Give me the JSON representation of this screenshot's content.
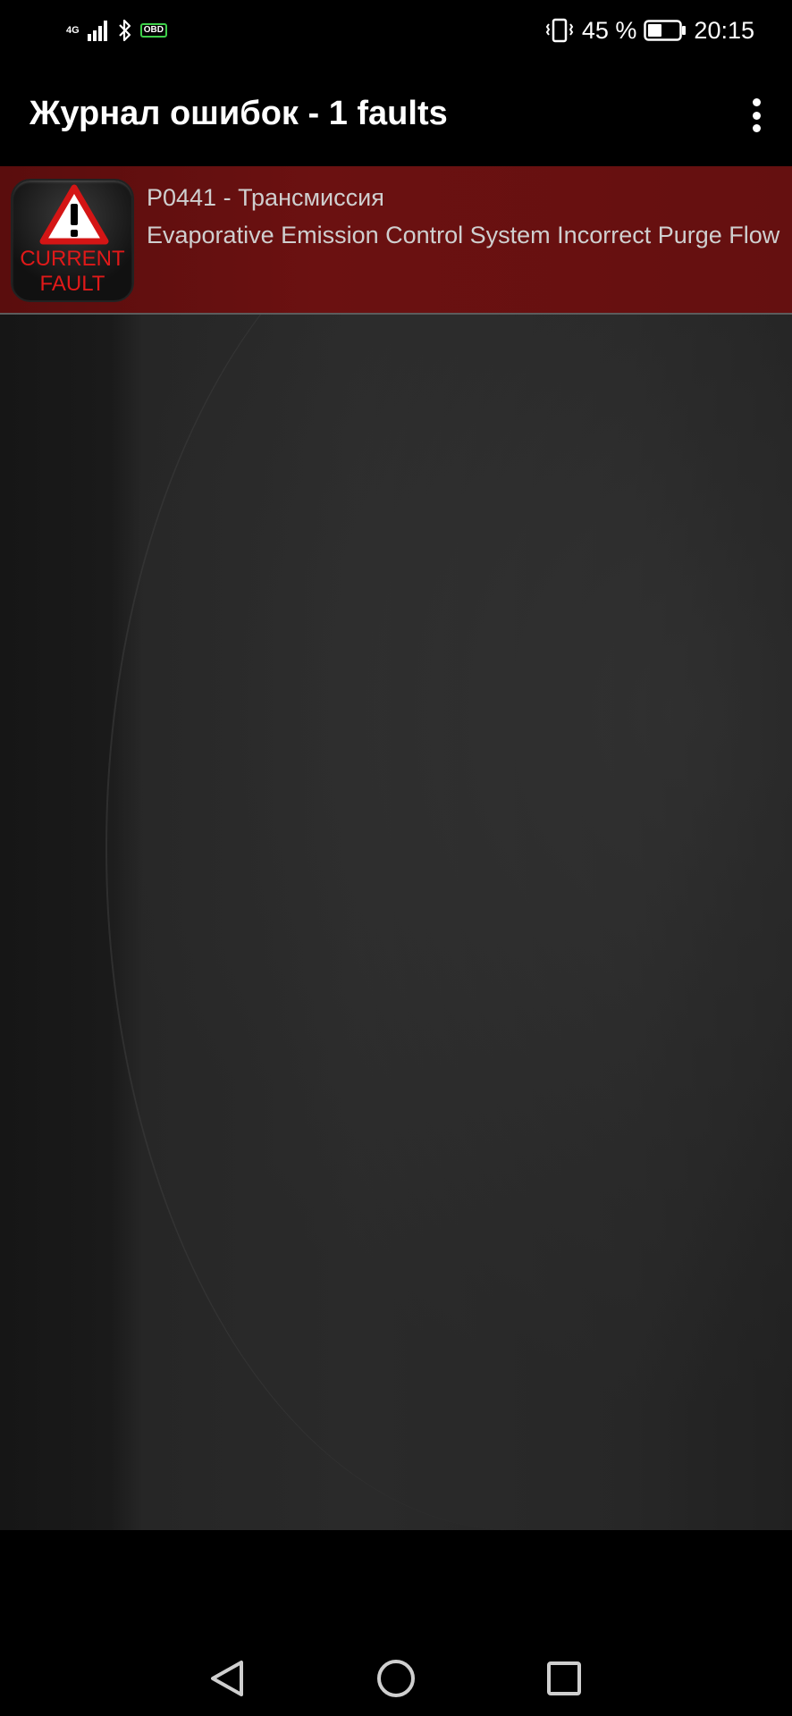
{
  "status_bar": {
    "network": "4G",
    "obd_badge": "OBD",
    "battery_percent": "45 %",
    "battery_level": 0.45,
    "time": "20:15"
  },
  "app_bar": {
    "title": "Журнал ошибок - 1 faults",
    "menu_icon": "more-vert-icon"
  },
  "faults": [
    {
      "badge_line1": "CURRENT",
      "badge_line2": "FAULT",
      "code_line": "P0441 - Трансмиссия",
      "description": "Evaporative Emission Control System Incorrect Purge Flow"
    }
  ],
  "nav_bar": {
    "back_icon": "back-triangle-icon",
    "home_icon": "home-circle-icon",
    "recents_icon": "recents-square-icon"
  },
  "colors": {
    "fault_row_bg": "#6b1111",
    "fault_icon_red": "#e01919",
    "obd_green": "#3ecf4a",
    "text_primary": "#ffffff",
    "text_secondary": "#cfcfcf"
  }
}
